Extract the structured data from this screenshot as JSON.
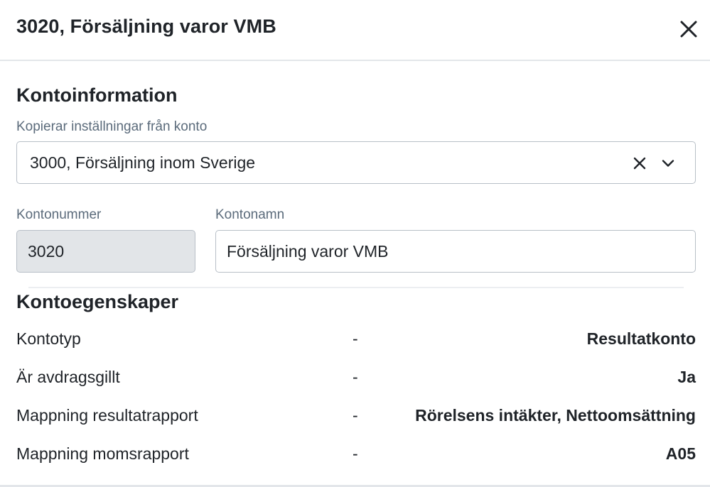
{
  "dialog": {
    "title": "3020, Försäljning varor VMB",
    "close_icon": "close-icon"
  },
  "account_info": {
    "section_title": "Kontoinformation",
    "copy_label": "Kopierar inställningar från konto",
    "copy_value": "3000, Försäljning inom Sverige",
    "clear_icon": "clear-icon",
    "chevron_icon": "chevron-down-icon",
    "number_label": "Kontonummer",
    "number_value": "3020",
    "name_label": "Kontonamn",
    "name_value": "Försäljning varor VMB"
  },
  "account_properties": {
    "section_title": "Kontoegenskaper",
    "rows": [
      {
        "label": "Kontotyp",
        "dash": "-",
        "value": "Resultatkonto"
      },
      {
        "label": "Är avdragsgillt",
        "dash": "-",
        "value": "Ja"
      },
      {
        "label": "Mappning resultatrapport",
        "dash": "-",
        "value": "Rörelsens intäkter, Nettoomsättning"
      },
      {
        "label": "Mappning momsrapport",
        "dash": "-",
        "value": "A05"
      }
    ]
  },
  "colors": {
    "text": "#1f2328",
    "label": "#5b6b7b",
    "border": "#b8bfc7",
    "readonly_bg": "#e2e5e8"
  }
}
